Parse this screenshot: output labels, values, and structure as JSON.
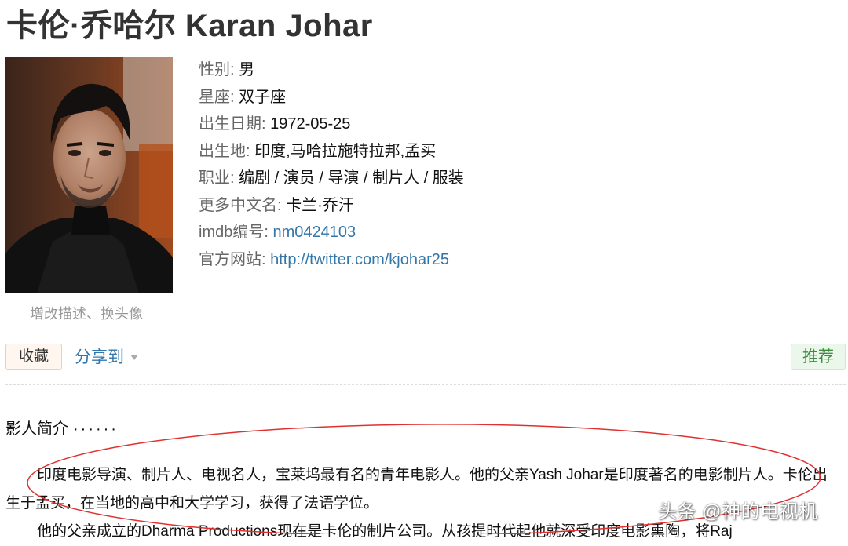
{
  "page": {
    "title": "卡伦·乔哈尔 Karan Johar"
  },
  "avatar": {
    "edit_label": "增改描述、换头像"
  },
  "info": {
    "gender": {
      "label": "性别",
      "sep": ": ",
      "value": "男"
    },
    "zodiac": {
      "label": "星座",
      "sep": ": ",
      "value": "双子座"
    },
    "birth_date": {
      "label": "出生日期",
      "sep": ": ",
      "value": "1972-05-25"
    },
    "birth_place": {
      "label": "出生地",
      "sep": ": ",
      "value": "印度,马哈拉施特拉邦,孟买"
    },
    "profession": {
      "label": "职业",
      "sep": ": ",
      "value": "编剧 / 演员 / 导演 / 制片人 / 服装"
    },
    "other_names": {
      "label": "更多中文名",
      "sep": ": ",
      "value": "卡兰·乔汗"
    },
    "imdb": {
      "label": "imdb编号",
      "sep": ": ",
      "value": "nm0424103"
    },
    "website": {
      "label": "官方网站",
      "sep": ": ",
      "value": "http://twitter.com/kjohar25"
    }
  },
  "actions": {
    "collect_label": "收藏",
    "share_label": "分享到",
    "recommend_label": "推荐"
  },
  "intro": {
    "title": "影人简介",
    "dots": "······",
    "paragraph1": "印度电影导演、制片人、电视名人，宝莱坞最有名的青年电影人。他的父亲Yash Johar是印度著名的电影制片人。卡伦出生于孟买，在当地的高中和大学学习，获得了法语学位。",
    "paragraph2": "他的父亲成立的Dharma Productions现在是卡伦的制片公司。从孩提时代起他就深受印度电影熏陶，将Raj"
  },
  "watermark": {
    "text": "头条 @神的电视机"
  },
  "colors": {
    "link": "#3377aa",
    "recommend_bg": "#eaf7ea",
    "recommend_text": "#3e8c3e",
    "collect_bg": "#fff7ef",
    "annotation": "#e03030"
  },
  "icons": {
    "share_caret": "caret-down-icon"
  }
}
